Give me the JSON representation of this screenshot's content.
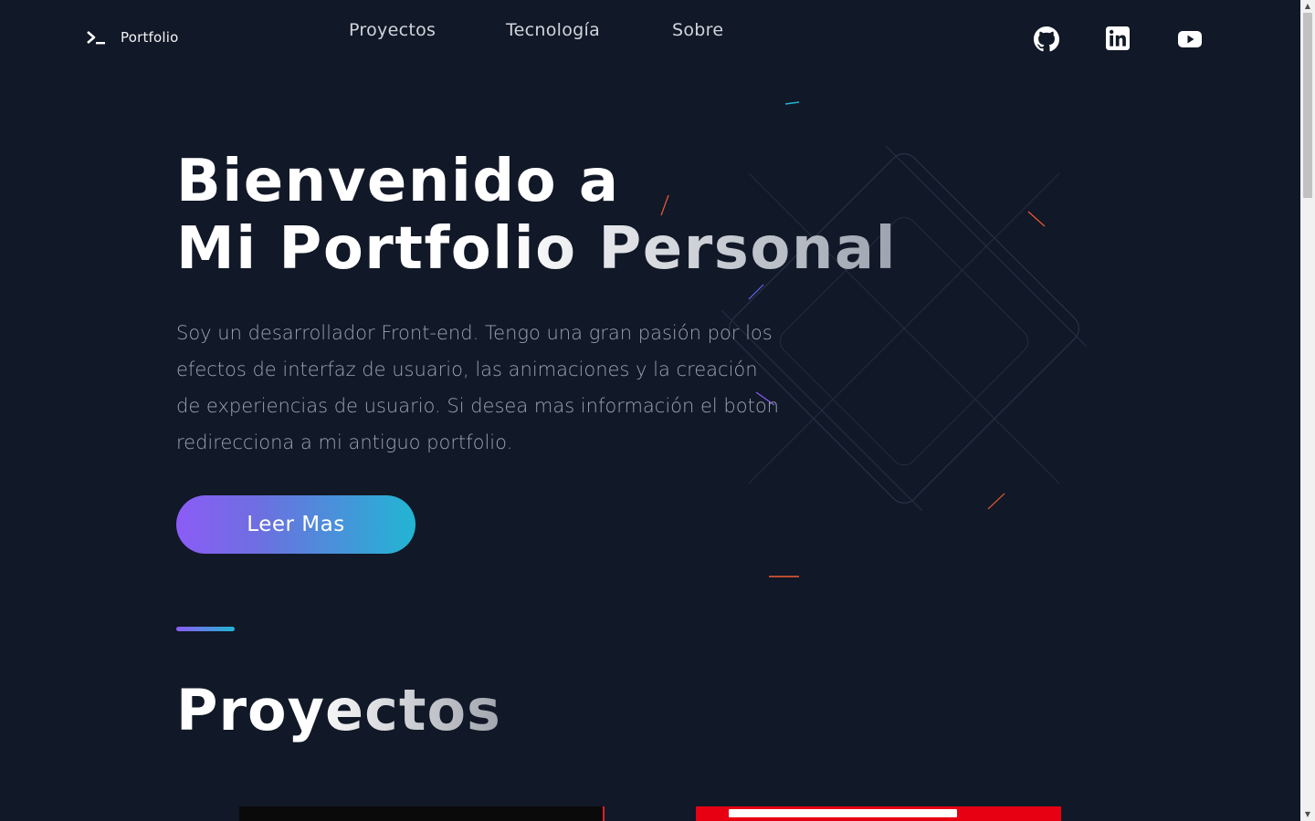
{
  "nav": {
    "brand_label": "Portfolio",
    "links": [
      "Proyectos",
      "Tecnología",
      "Sobre"
    ],
    "socials": [
      "github-icon",
      "linkedin-icon",
      "youtube-icon"
    ]
  },
  "hero": {
    "title_line1": "Bienvenido a",
    "title_line2": "Mi Portfolio Personal",
    "text": "Soy un desarrollador Front-end. Tengo una gran pasión por los efectos de interfaz de usuario, las animaciones y la creación de experiencias de usuario. Si desea mas información el boton redirecciona a mi antiguo portfolio.",
    "cta_label": "Leer Mas"
  },
  "projects": {
    "title": "Proyectos"
  },
  "colors": {
    "background": "#111827",
    "gradient_start": "#8b5cf6",
    "gradient_end": "#22b5d3"
  }
}
